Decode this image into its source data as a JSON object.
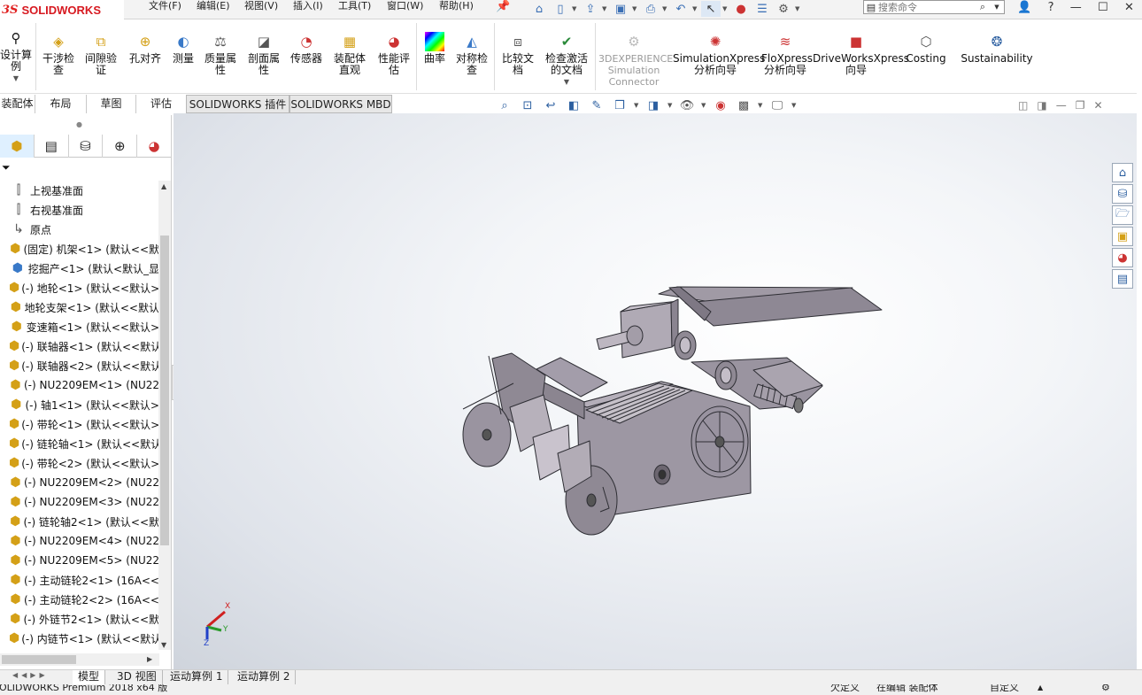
{
  "app": {
    "brand_ds": "3S",
    "brand_name": "SOLIDWORKS"
  },
  "menu": [
    "文件(F)",
    "编辑(E)",
    "视图(V)",
    "插入(I)",
    "工具(T)",
    "窗口(W)",
    "帮助(H)"
  ],
  "search": {
    "placeholder": "搜索命令"
  },
  "ribbon": {
    "design_study": "设计算例",
    "interference": "干涉检查",
    "clearance": "间隙验证",
    "hole_align": "孔对齐",
    "measure": "测量",
    "mass_props": "质量属性",
    "section_props": "剖面属性",
    "sensors": "传感器",
    "asm_visual": "装配体直观",
    "perf_eval": "性能评估",
    "curvature": "曲率",
    "symmetry": "对称检查",
    "compare_docs": "比较文档",
    "check_active": "检查激活的文档",
    "exp_sim": "3DEXPERIENCE Simulation Connector",
    "simx": "SimulationXpress 分析向导",
    "flox": "FloXpress 分析向导",
    "drivex": "DriveWorksXpress 向导",
    "costing": "Costing",
    "sustain": "Sustainability"
  },
  "tabs": [
    "装配体",
    "布局",
    "草图",
    "评估",
    "SOLIDWORKS 插件",
    "SOLIDWORKS MBD"
  ],
  "tree": [
    {
      "icon": "plane",
      "label": "上视基准面"
    },
    {
      "icon": "plane",
      "label": "右视基准面"
    },
    {
      "icon": "origin",
      "label": "原点"
    },
    {
      "icon": "part",
      "label": "(固定) 机架<1> (默认<<默"
    },
    {
      "icon": "asm",
      "label": "挖掘产<1> (默认<默认_显"
    },
    {
      "icon": "part",
      "label": "(-) 地轮<1> (默认<<默认>"
    },
    {
      "icon": "part",
      "label": "地轮支架<1> (默认<<默认"
    },
    {
      "icon": "part",
      "label": "变速箱<1> (默认<<默认>"
    },
    {
      "icon": "part",
      "label": "(-) 联轴器<1> (默认<<默认"
    },
    {
      "icon": "part",
      "label": "(-) 联轴器<2> (默认<<默认"
    },
    {
      "icon": "part",
      "label": "(-) NU2209EM<1> (NU22"
    },
    {
      "icon": "part",
      "label": "(-) 轴1<1> (默认<<默认>"
    },
    {
      "icon": "part",
      "label": "(-) 带轮<1> (默认<<默认>"
    },
    {
      "icon": "part",
      "label": "(-) 链轮轴<1> (默认<<默认"
    },
    {
      "icon": "part",
      "label": "(-) 带轮<2> (默认<<默认>"
    },
    {
      "icon": "part",
      "label": "(-) NU2209EM<2> (NU22"
    },
    {
      "icon": "part",
      "label": "(-) NU2209EM<3> (NU22"
    },
    {
      "icon": "part",
      "label": "(-) 链轮轴2<1> (默认<<默"
    },
    {
      "icon": "part",
      "label": "(-) NU2209EM<4> (NU22"
    },
    {
      "icon": "part",
      "label": "(-) NU2209EM<5> (NU22"
    },
    {
      "icon": "part",
      "label": "(-) 主动链轮2<1> (16A<<"
    },
    {
      "icon": "part",
      "label": "(-) 主动链轮2<2> (16A<<"
    },
    {
      "icon": "part",
      "label": "(-) 外链节2<1> (默认<<默"
    },
    {
      "icon": "part",
      "label": "(-) 内链节<1> (默认<<默认"
    }
  ],
  "bottom_tabs": [
    "模型",
    "3D 视图",
    "运动算例 1",
    "运动算例 2"
  ],
  "status": {
    "product": "SOLIDWORKS Premium 2018 x64 版",
    "state1": "欠定义",
    "state2": "在编辑 装配体",
    "custom": "自定义"
  },
  "triad": {
    "x": "X",
    "y": "Y",
    "z": "Z"
  }
}
